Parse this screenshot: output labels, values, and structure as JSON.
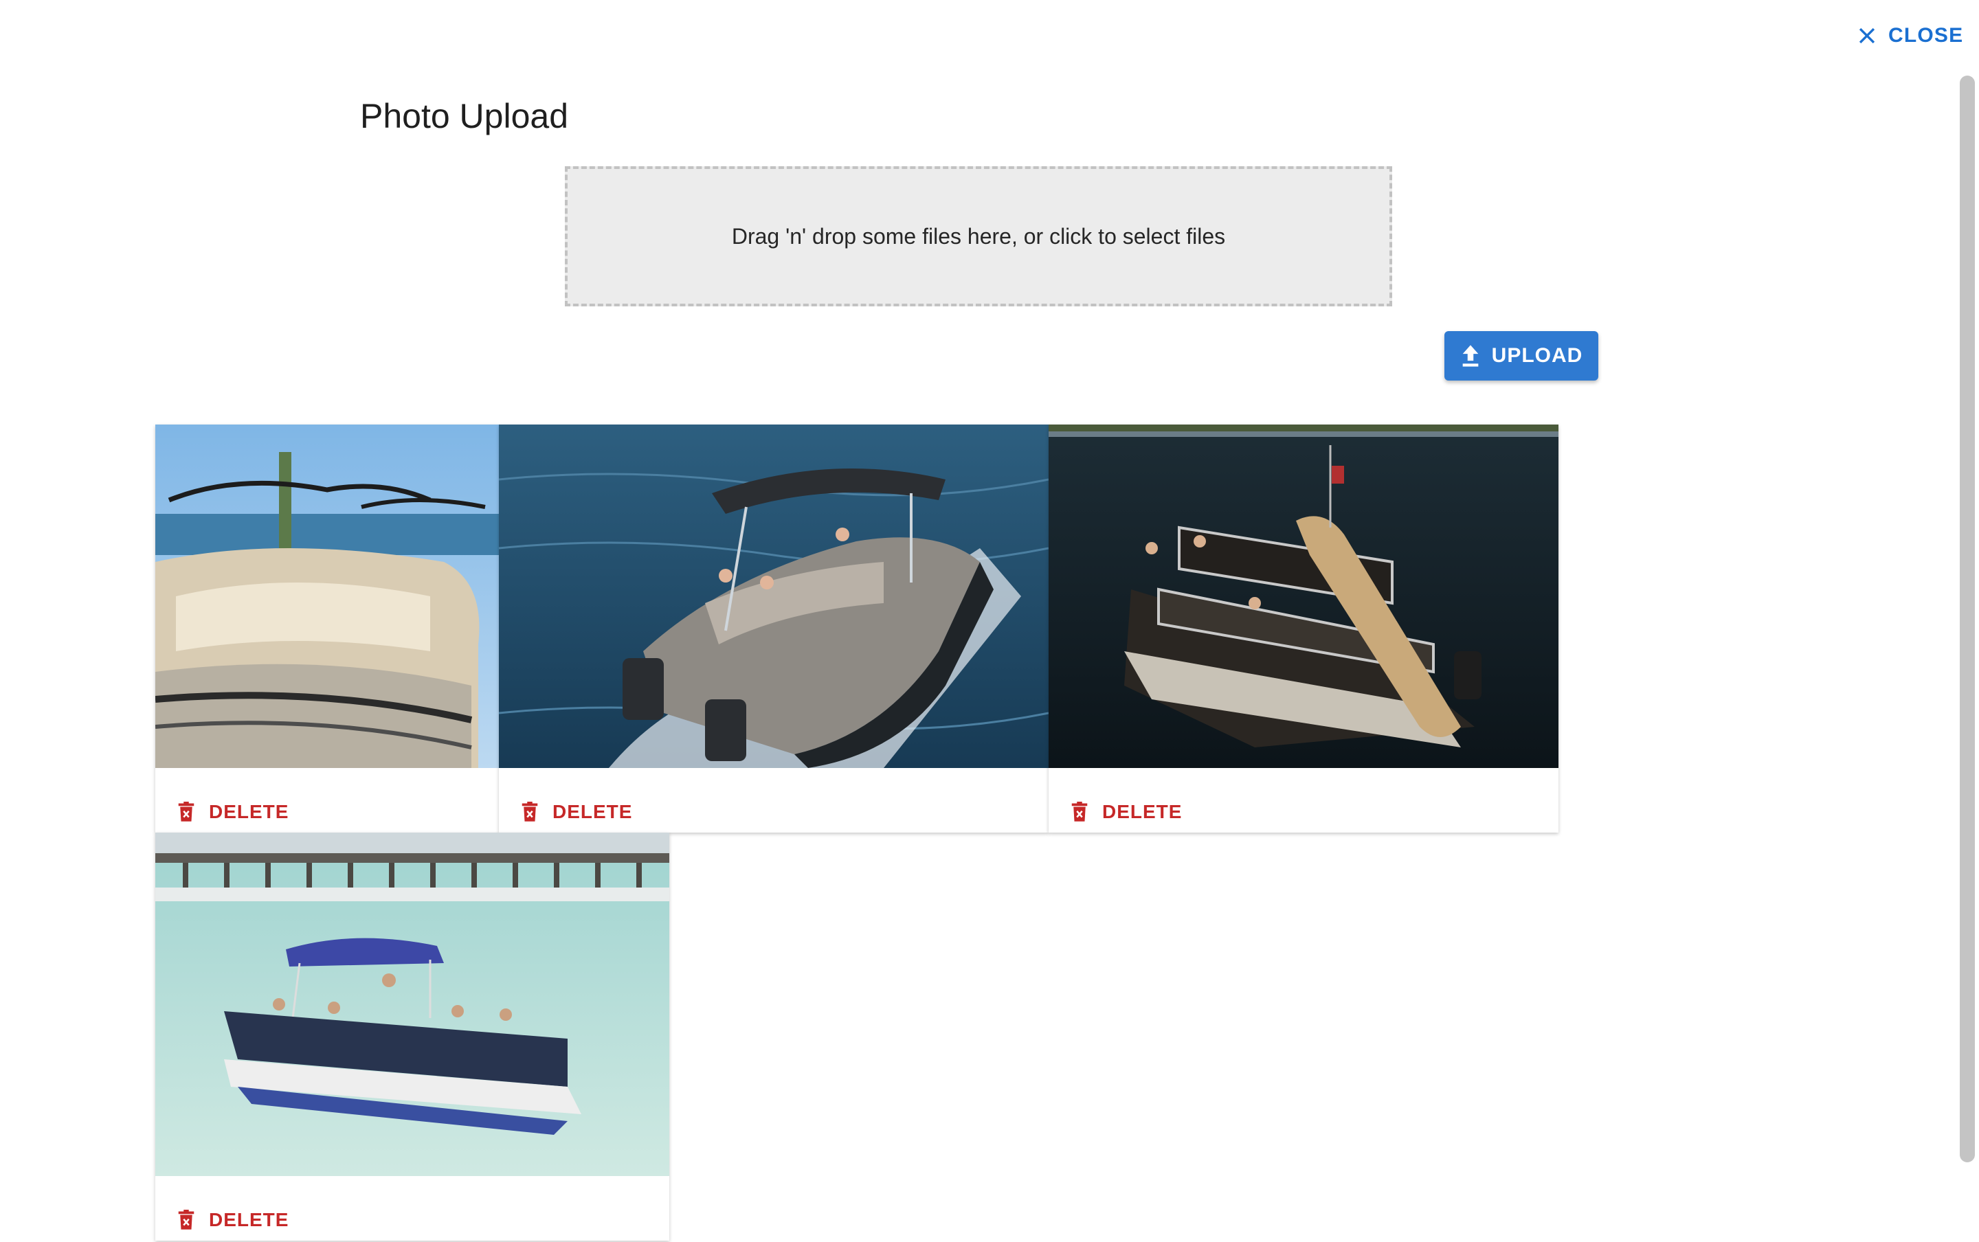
{
  "dialog": {
    "close_label": "CLOSE",
    "title": "Photo Upload",
    "dropzone_text": "Drag 'n' drop some files here, or click to select files",
    "upload_label": "UPLOAD"
  },
  "photos": [
    {
      "alt": "pontoon boat seating",
      "delete_label": "DELETE"
    },
    {
      "alt": "luxury tritoon boat on water",
      "delete_label": "DELETE"
    },
    {
      "alt": "double decker pontoon with slide",
      "delete_label": "DELETE"
    },
    {
      "alt": "pontoon boat with canopy near bridge",
      "delete_label": "DELETE"
    }
  ],
  "colors": {
    "accent": "#2f7ad1",
    "close": "#1a6fd1",
    "danger": "#c62828",
    "dropzone_bg": "#ececec"
  }
}
